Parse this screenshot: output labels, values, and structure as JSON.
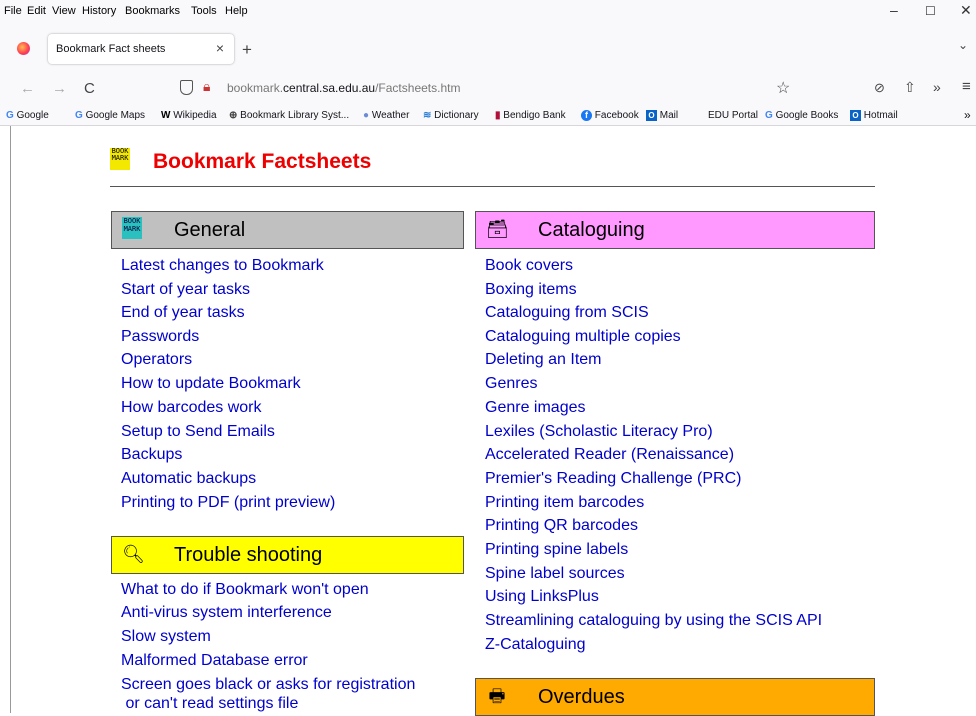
{
  "menu": [
    "File",
    "Edit",
    "View",
    "History",
    "Bookmarks",
    "Tools",
    "Help"
  ],
  "window_controls": {
    "minimize": "–",
    "maximize": "☐",
    "close": "✕"
  },
  "tab": {
    "title": "Bookmark Fact sheets",
    "close": "×",
    "new": "+"
  },
  "nav": {
    "back": "←",
    "forward": "→",
    "reload": "C",
    "url_prefix": "bookmark.",
    "url_domain": "central.sa.edu.au",
    "url_path": "/Factsheets.htm",
    "star": "☆",
    "pocket": "⊘",
    "share": "⇧",
    "more": "»",
    "menu": "≡"
  },
  "bookmarks": [
    {
      "label": "Google",
      "icon": "G"
    },
    {
      "label": "Google Maps",
      "icon": "G"
    },
    {
      "label": "Wikipedia",
      "icon": "W"
    },
    {
      "label": "Bookmark Library Syst...",
      "icon": "⊕"
    },
    {
      "label": "Weather",
      "icon": "●"
    },
    {
      "label": "Dictionary",
      "icon": "≋"
    },
    {
      "label": "Bendigo Bank",
      "icon": "▮"
    },
    {
      "label": "Facebook",
      "icon": "f"
    },
    {
      "label": "Mail",
      "icon": "O"
    },
    {
      "label": "EDU Portal",
      "icon": ""
    },
    {
      "label": "Google Books",
      "icon": "G"
    },
    {
      "label": "Hotmail",
      "icon": "O"
    }
  ],
  "bookmarks_overflow": "»",
  "page": {
    "title": "Bookmark Factsheets",
    "logo_text": "BOOK MARK"
  },
  "general": {
    "heading": "General",
    "links": [
      "Latest changes to Bookmark",
      "Start of year tasks",
      "End of year tasks",
      "Passwords",
      "Operators",
      "How to update Bookmark",
      "How barcodes work",
      "Setup to Send Emails",
      "Backups",
      "Automatic backups",
      "Printing to PDF (print preview)"
    ]
  },
  "trouble": {
    "heading": "Trouble shooting",
    "links": [
      "What to do if Bookmark won't open",
      "Anti-virus system interference",
      "Slow system",
      "Malformed Database error",
      "Screen goes black or asks for registration",
      " or can't read settings file"
    ]
  },
  "cataloguing": {
    "heading": "Cataloguing",
    "links": [
      "Book covers",
      "Boxing items",
      "Cataloguing from SCIS",
      "Cataloguing multiple copies",
      "Deleting an Item",
      "Genres",
      "Genre images",
      "Lexiles (Scholastic Literacy Pro)",
      "Accelerated Reader (Renaissance)",
      "Premier's Reading Challenge (PRC)",
      "Printing item barcodes",
      "Printing QR barcodes",
      "Printing spine labels",
      "Spine label sources",
      "Using LinksPlus",
      "Streamlining cataloguing by using the SCIS API",
      "Z-Cataloguing"
    ]
  },
  "overdues": {
    "heading": "Overdues"
  },
  "colors": {
    "general_bg": "#c0c0c0",
    "cataloguing_bg": "#ff99ff",
    "trouble_bg": "#ffff00",
    "overdues_bg": "#ffaa00",
    "link": "#0000cc",
    "title": "#ee0000"
  }
}
